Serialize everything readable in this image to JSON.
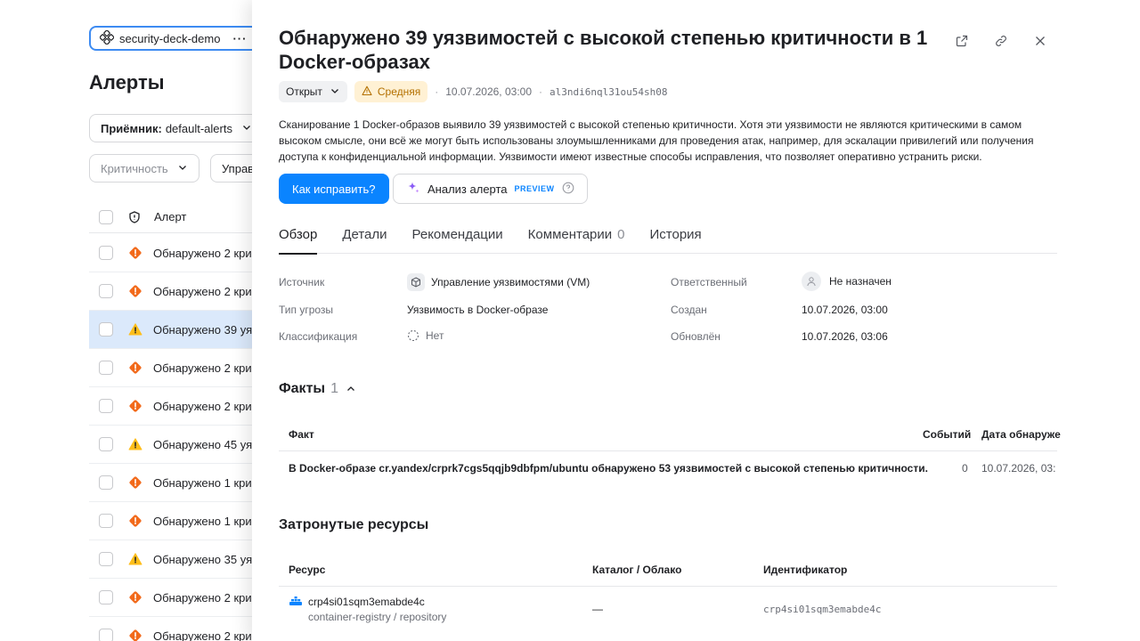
{
  "project": {
    "name": "security-deck-demo",
    "menu": "···"
  },
  "page_title": "Алерты",
  "filters": {
    "receiver_label": "Приёмник:",
    "receiver_value": "default-alerts",
    "severity_placeholder": "Критичность",
    "management_label": "Управ"
  },
  "list": {
    "header_label": "Алерт",
    "rows": [
      {
        "text": "Обнаружено 2 кри",
        "severity": "high"
      },
      {
        "text": "Обнаружено 2 кри",
        "severity": "high"
      },
      {
        "text": "Обнаружено 39 уя",
        "severity": "medium",
        "selected": true
      },
      {
        "text": "Обнаружено 2 кри",
        "severity": "high"
      },
      {
        "text": "Обнаружено 2 кри",
        "severity": "high"
      },
      {
        "text": "Обнаружено 45 уя",
        "severity": "medium"
      },
      {
        "text": "Обнаружено 1 кри",
        "severity": "high"
      },
      {
        "text": "Обнаружено 1 кри",
        "severity": "high"
      },
      {
        "text": "Обнаружено 35 уя",
        "severity": "medium"
      },
      {
        "text": "Обнаружено 2 кри",
        "severity": "high"
      },
      {
        "text": "Обнаружено 2 кри",
        "severity": "high"
      }
    ]
  },
  "drawer": {
    "title": "Обнаружено 39 уязвимостей с высокой степенью критичности в 1 Docker-образах",
    "status": "Открыт",
    "severity": "Средняя",
    "sep": "·",
    "date": "10.07.2026, 03:00",
    "alert_id": "al3ndi6nql31ou54sh08",
    "description": "Сканирование 1 Docker-образов выявило 39 уязвимостей с высокой степенью критичности. Хотя эти уязвимости не являются критическими в самом высоком смысле, они всё же могут быть использованы злоумышленниками для проведения атак, например, для эскалации привилегий или получения доступа к конфиденциальной информации. Уязвимости имеют известные способы исправления, что позволяет оперативно устранить риски.",
    "fix_button": "Как исправить?",
    "ai_button": "Анализ алерта",
    "ai_badge": "PREVIEW",
    "tabs": {
      "overview": "Обзор",
      "details": "Детали",
      "recommendations": "Рекомендации",
      "comments": "Комментарии",
      "comments_count": "0",
      "history": "История"
    },
    "props": {
      "source_label": "Источник",
      "source_value": "Управление уязвимостями (VM)",
      "threat_label": "Тип угрозы",
      "threat_value": "Уязвимость в Docker-образе",
      "class_label": "Классификация",
      "class_value": "Нет",
      "assignee_label": "Ответственный",
      "assignee_value": "Не назначен",
      "created_label": "Создан",
      "created_value": "10.07.2026, 03:00",
      "updated_label": "Обновлён",
      "updated_value": "10.07.2026, 03:06"
    },
    "facts": {
      "title": "Факты",
      "count": "1",
      "col_fact": "Факт",
      "col_events": "Событий",
      "col_date": "Дата обнаруже",
      "rows": [
        {
          "fact": "В Docker-образе cr.yandex/crprk7cgs5qqjb9dbfpm/ubuntu обнаружено 53 уязвимостей с высокой степенью критичности.",
          "events": "0",
          "date": "10.07.2026, 03:"
        }
      ]
    },
    "resources": {
      "title": "Затронутые ресурсы",
      "col_resource": "Ресурс",
      "col_catalog": "Каталог / Облако",
      "col_id": "Идентификатор",
      "rows": [
        {
          "name": "crp4si01sqm3emabde4c",
          "type": "container-registry / repository",
          "catalog": "—",
          "id": "crp4si01sqm3emabde4c"
        }
      ]
    }
  },
  "colors": {
    "accent": "#0a84ff",
    "high": "#f26a1b",
    "medium": "#ffbe1a",
    "selected_row": "#dbe9fb"
  }
}
